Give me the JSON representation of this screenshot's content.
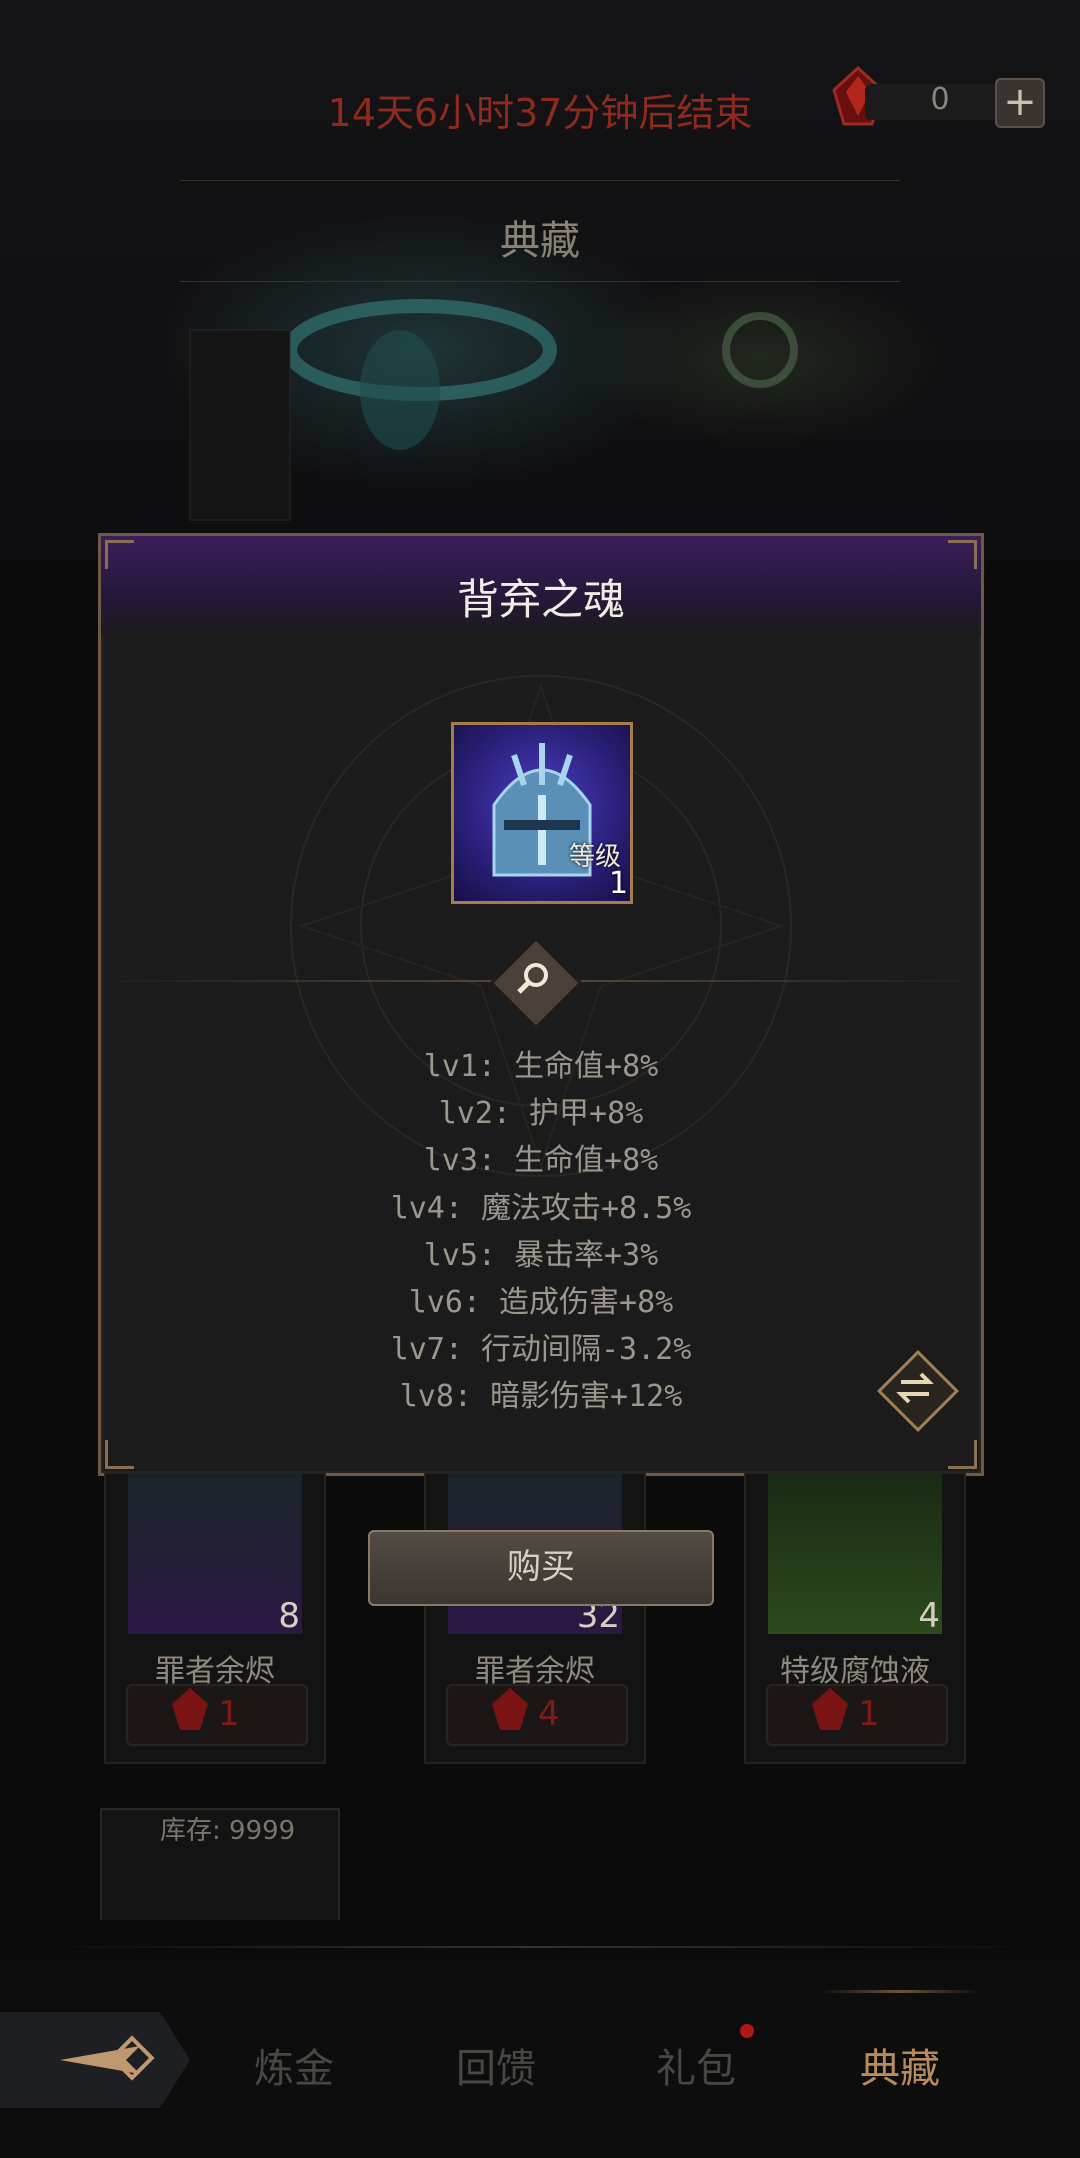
{
  "header": {
    "timer": "14天6小时37分钟后结束",
    "currency_value": "0",
    "plus_label": "+",
    "page_title": "典藏"
  },
  "modal": {
    "title": "背弃之魂",
    "item": {
      "level_label": "等级",
      "level": "1"
    },
    "stats": [
      "lv1: 生命值+8%",
      "lv2: 护甲+8%",
      "lv3: 生命值+8%",
      "lv4: 魔法攻击+8.5%",
      "lv5: 暴击率+3%",
      "lv6: 造成伤害+8%",
      "lv7: 行动间隔-3.2%",
      "lv8: 暗影伤害+12%"
    ]
  },
  "buy_label": "购买",
  "shop_items": [
    {
      "name": "罪者余烬",
      "count": "8",
      "price": "1"
    },
    {
      "name": "罪者余烬",
      "count": "32",
      "price": "4"
    },
    {
      "name": "特级腐蚀液",
      "count": "4",
      "price": "1"
    }
  ],
  "stock_label": "库存: 9999",
  "nav": {
    "tabs": [
      "炼金",
      "回馈",
      "礼包",
      "典藏"
    ]
  },
  "colors": {
    "timer": "#8e2a1e",
    "accent": "#b98a5c",
    "modal_header": "#3b1e5a",
    "price": "#7a1e18"
  },
  "icons": [
    "red-gem-icon",
    "magnify-icon",
    "swap-icon",
    "back-arrow-icon",
    "helmet-icon"
  ]
}
